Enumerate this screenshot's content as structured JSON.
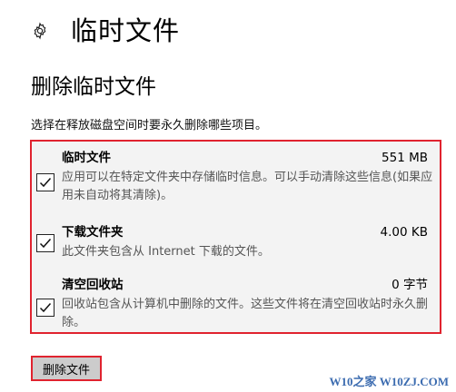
{
  "header": {
    "title": "临时文件",
    "icon": "gear-icon"
  },
  "section": {
    "title": "删除临时文件",
    "description": "选择在释放磁盘空间时要永久删除哪些项目。"
  },
  "items": [
    {
      "name": "临时文件",
      "size": "551 MB",
      "description": "应用可以在特定文件夹中存储临时信息。可以手动清除这些信息(如果应用未自动将其清除)。",
      "checked": true
    },
    {
      "name": "下载文件夹",
      "size": "4.00 KB",
      "description": "此文件夹包含从 Internet 下载的文件。",
      "checked": true
    },
    {
      "name": "清空回收站",
      "size": "0 字节",
      "description": "回收站包含从计算机中删除的文件。这些文件将在清空回收站时永久删除。",
      "checked": true
    }
  ],
  "actions": {
    "delete_label": "删除文件"
  },
  "watermark": "W10之家 W10ZJ.COM",
  "colors": {
    "highlight": "#e0232f",
    "panel": "#f3f3f3",
    "button": "#cccccc",
    "watermark": "#3c6cb0"
  }
}
